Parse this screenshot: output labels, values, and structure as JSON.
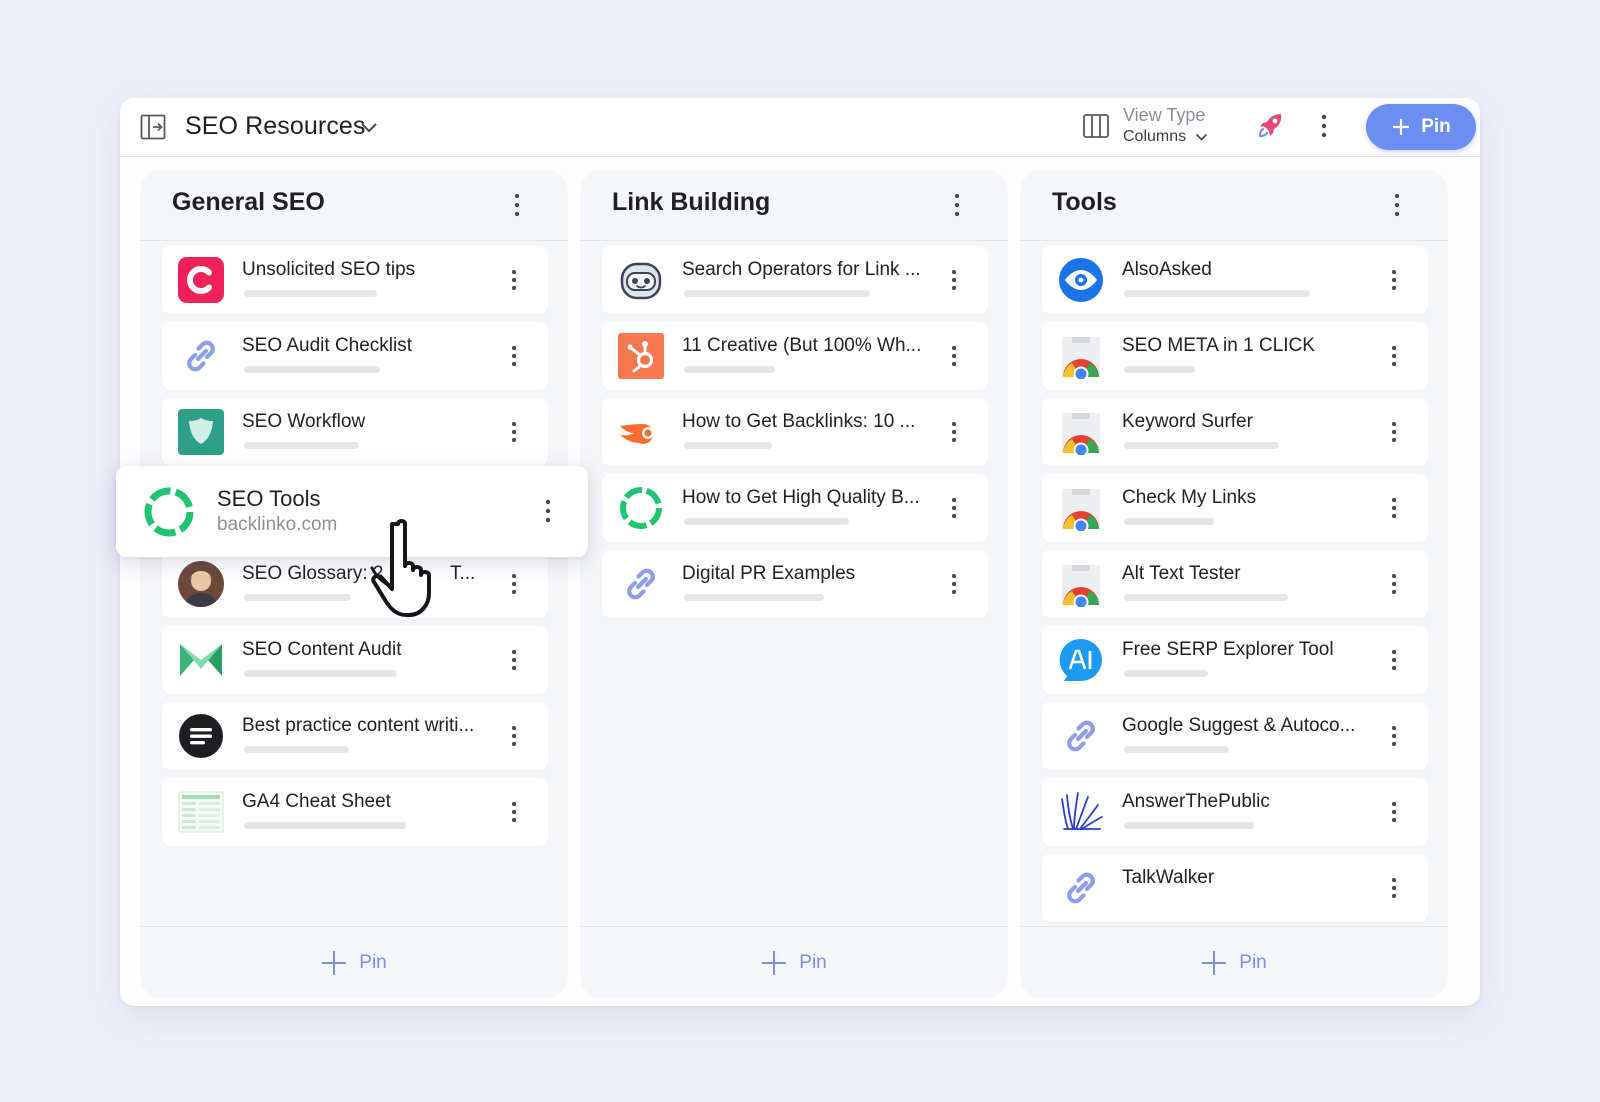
{
  "header": {
    "title": "SEO Resources",
    "view_type_label": "View Type",
    "view_type_value": "Columns",
    "pin_label": "Pin",
    "accent": "#6c8ef2"
  },
  "columns": [
    {
      "title": "General SEO",
      "footer_label": "Pin",
      "items": [
        {
          "label": "Unsolicited SEO tips",
          "icon": "letter-c-icon",
          "progress": 0.58
        },
        {
          "label": "SEO Audit Checklist",
          "icon": "link-icon",
          "progress": 0.6
        },
        {
          "label": "SEO Workflow",
          "icon": "shield-app-icon",
          "progress": 0.5
        },
        {
          "label": "SEO Glossary: 2",
          "label_tail": "T...",
          "icon": "person-photo-icon",
          "progress": 0.47
        },
        {
          "label": "SEO Content Audit",
          "icon": "m-logo-icon",
          "progress": 0.67
        },
        {
          "label": "Best practice content writi...",
          "icon": "lines-circle-icon",
          "progress": 0.46
        },
        {
          "label": "GA4 Cheat Sheet",
          "icon": "spreadsheet-thumbnail-icon",
          "progress": 0.7
        }
      ]
    },
    {
      "title": "Link Building",
      "footer_label": "Pin",
      "items": [
        {
          "label": "Search Operators for Link ...",
          "icon": "robot-icon",
          "progress": 0.82
        },
        {
          "label": "11 Creative (But 100% Wh...",
          "icon": "hubspot-icon",
          "progress": 0.4
        },
        {
          "label": "How to Get Backlinks: 10 ...",
          "icon": "semrush-icon",
          "progress": 0.39
        },
        {
          "label": "How to Get High Quality B...",
          "icon": "backlinko-ring-icon",
          "progress": 0.73
        },
        {
          "label": "Digital PR Examples",
          "icon": "link-icon",
          "progress": 0.62
        }
      ]
    },
    {
      "title": "Tools",
      "footer_label": "Pin",
      "items": [
        {
          "label": "AlsoAsked",
          "icon": "eye-logo-icon",
          "progress": 0.82
        },
        {
          "label": "SEO META in 1 CLICK",
          "icon": "chrome-extension-icon",
          "progress": 0.31
        },
        {
          "label": "Keyword Surfer",
          "icon": "chrome-extension-icon",
          "progress": 0.68
        },
        {
          "label": "Check My Links",
          "icon": "chrome-extension-icon",
          "progress": 0.39
        },
        {
          "label": "Alt Text Tester",
          "icon": "chrome-extension-icon",
          "progress": 0.71
        },
        {
          "label": "Free SERP Explorer Tool",
          "icon": "ai-chat-icon",
          "progress": 0.37
        },
        {
          "label": "Google Suggest & Autoco...",
          "icon": "link-icon",
          "progress": 0.46
        },
        {
          "label": "AnswerThePublic",
          "icon": "scribble-logo-icon",
          "progress": 0.57
        },
        {
          "label": "TalkWalker",
          "icon": "link-icon",
          "progress": 0
        }
      ]
    }
  ],
  "dragged_card": {
    "title": "SEO Tools",
    "url": "backlinko.com",
    "icon": "backlinko-ring-icon"
  }
}
